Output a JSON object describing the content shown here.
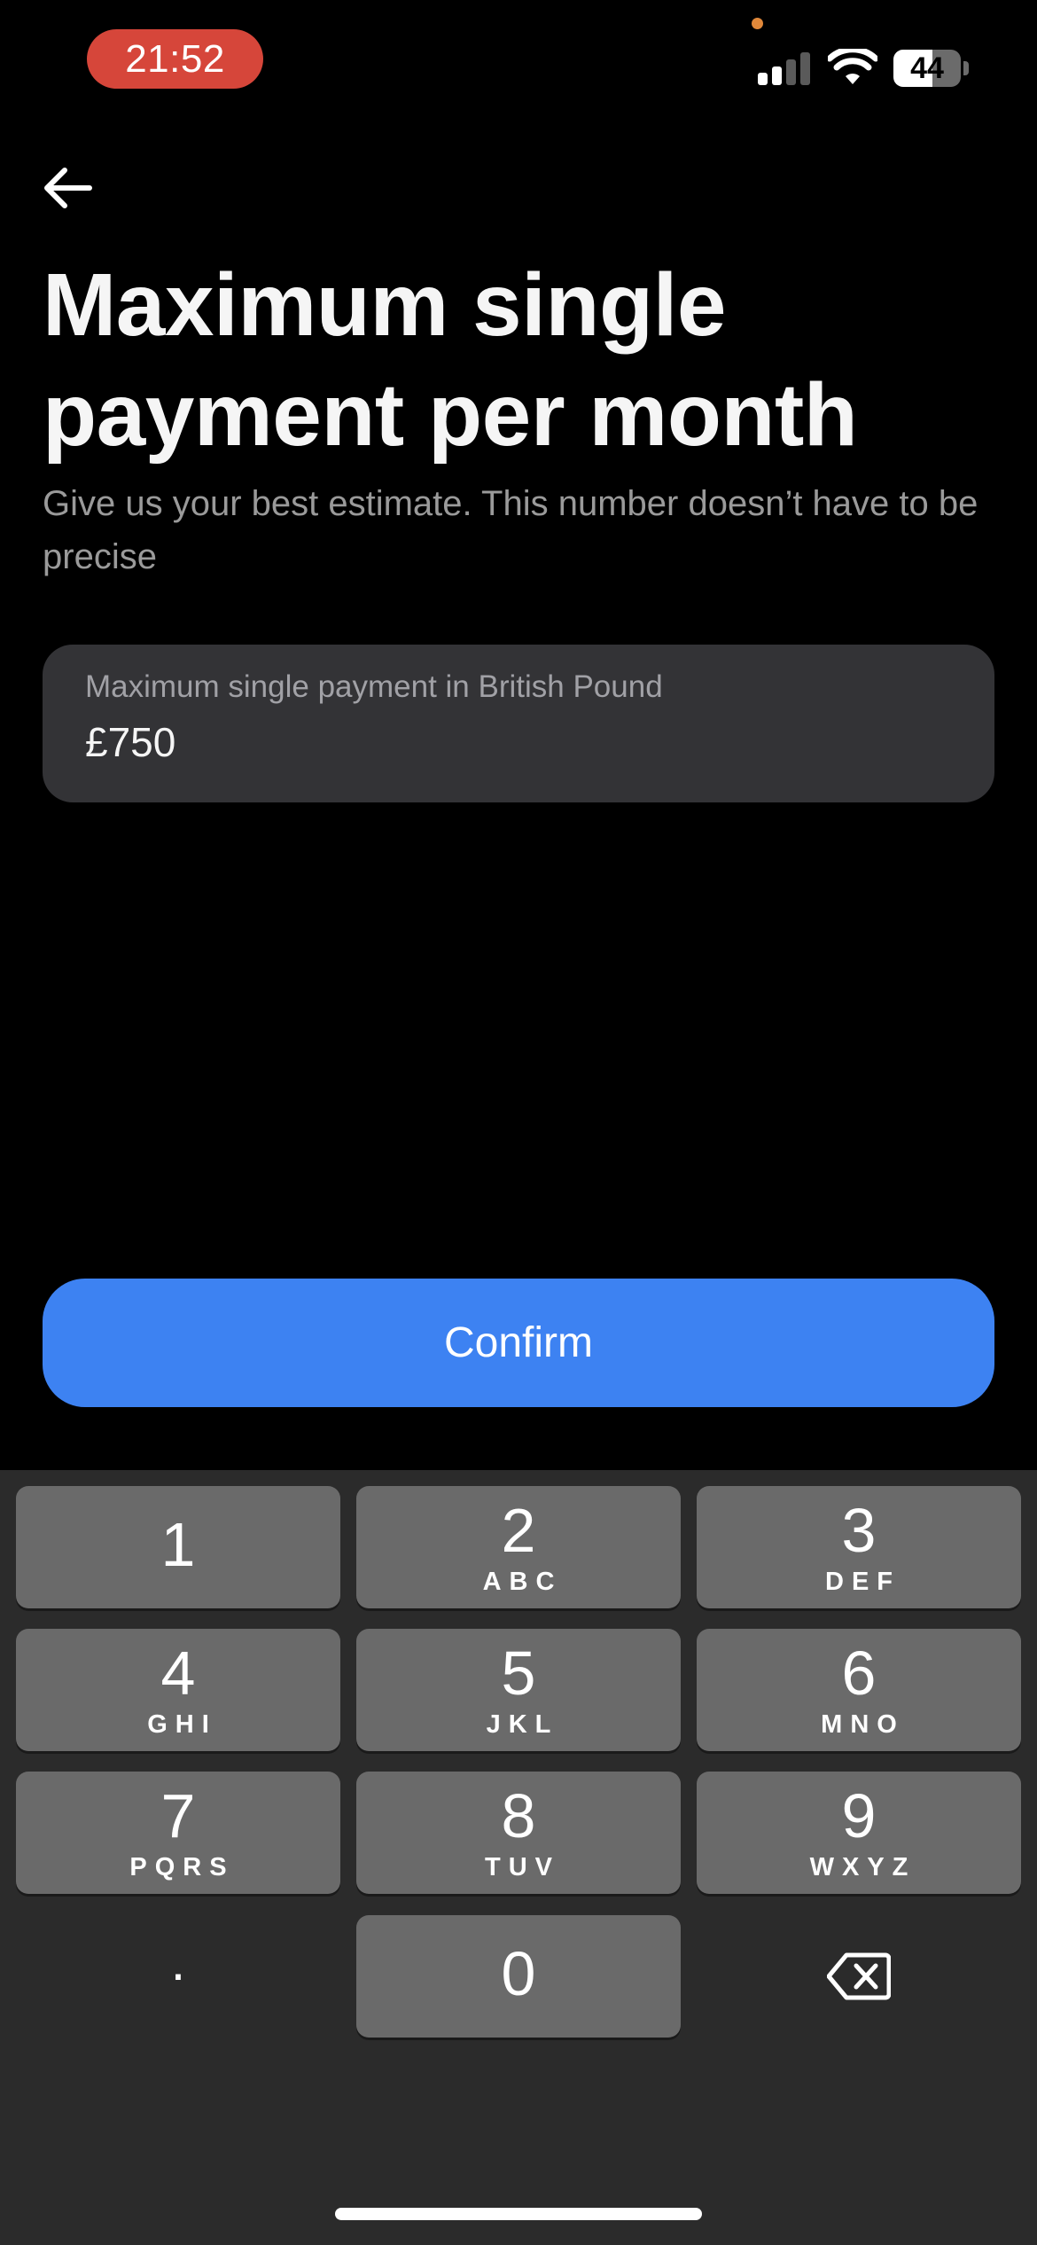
{
  "status_bar": {
    "time": "21:52",
    "battery_level": "44",
    "signal_bars_active": 2,
    "signal_bars_total": 4
  },
  "header": {
    "back_icon": "arrow-left-icon",
    "title": "Maximum single payment per month",
    "subtitle": "Give us your best estimate. This number doesn’t have to be precise"
  },
  "amount_field": {
    "label": "Maximum single payment in British Pound",
    "value": "£750"
  },
  "confirm_label": "Confirm",
  "keypad": {
    "keys": [
      {
        "num": "1",
        "letters": ""
      },
      {
        "num": "2",
        "letters": "ABC"
      },
      {
        "num": "3",
        "letters": "DEF"
      },
      {
        "num": "4",
        "letters": "GHI"
      },
      {
        "num": "5",
        "letters": "JKL"
      },
      {
        "num": "6",
        "letters": "MNO"
      },
      {
        "num": "7",
        "letters": "PQRS"
      },
      {
        "num": "8",
        "letters": "TUV"
      },
      {
        "num": "9",
        "letters": "WXYZ"
      },
      {
        "num": "0",
        "letters": ""
      }
    ],
    "decimal": ".",
    "delete_icon": "backspace-icon"
  },
  "colors": {
    "background": "#000000",
    "accent": "#3d82f2",
    "time_pill": "#d6463a",
    "field_bg": "#333336",
    "keypad_bg": "#2b2b2b",
    "key_bg": "#6a6a6a"
  }
}
